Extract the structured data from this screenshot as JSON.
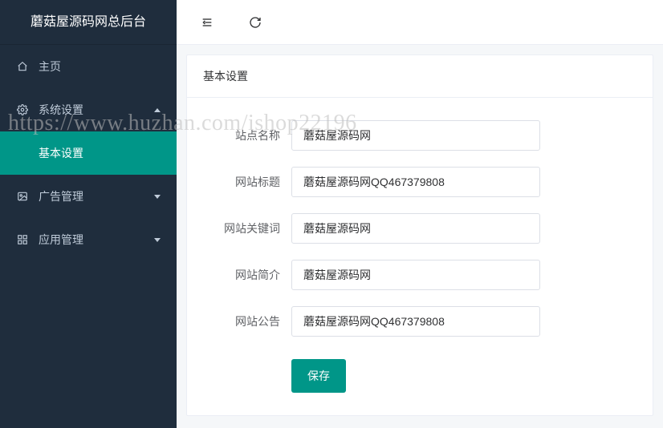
{
  "brand": "蘑菇屋源码网总后台",
  "nav": {
    "home": "主页",
    "system": "系统设置",
    "basic": "基本设置",
    "ads": "广告管理",
    "apps": "应用管理"
  },
  "card": {
    "title": "基本设置"
  },
  "form": {
    "site_name": {
      "label": "站点名称",
      "value": "蘑菇屋源码网"
    },
    "site_title": {
      "label": "网站标题",
      "value": "蘑菇屋源码网QQ467379808"
    },
    "site_keywords": {
      "label": "网站关键词",
      "value": "蘑菇屋源码网"
    },
    "site_desc": {
      "label": "网站简介",
      "value": "蘑菇屋源码网"
    },
    "site_notice": {
      "label": "网站公告",
      "value": "蘑菇屋源码网QQ467379808"
    },
    "save": "保存"
  },
  "watermark": "https://www.huzhan.com/ishop22196"
}
